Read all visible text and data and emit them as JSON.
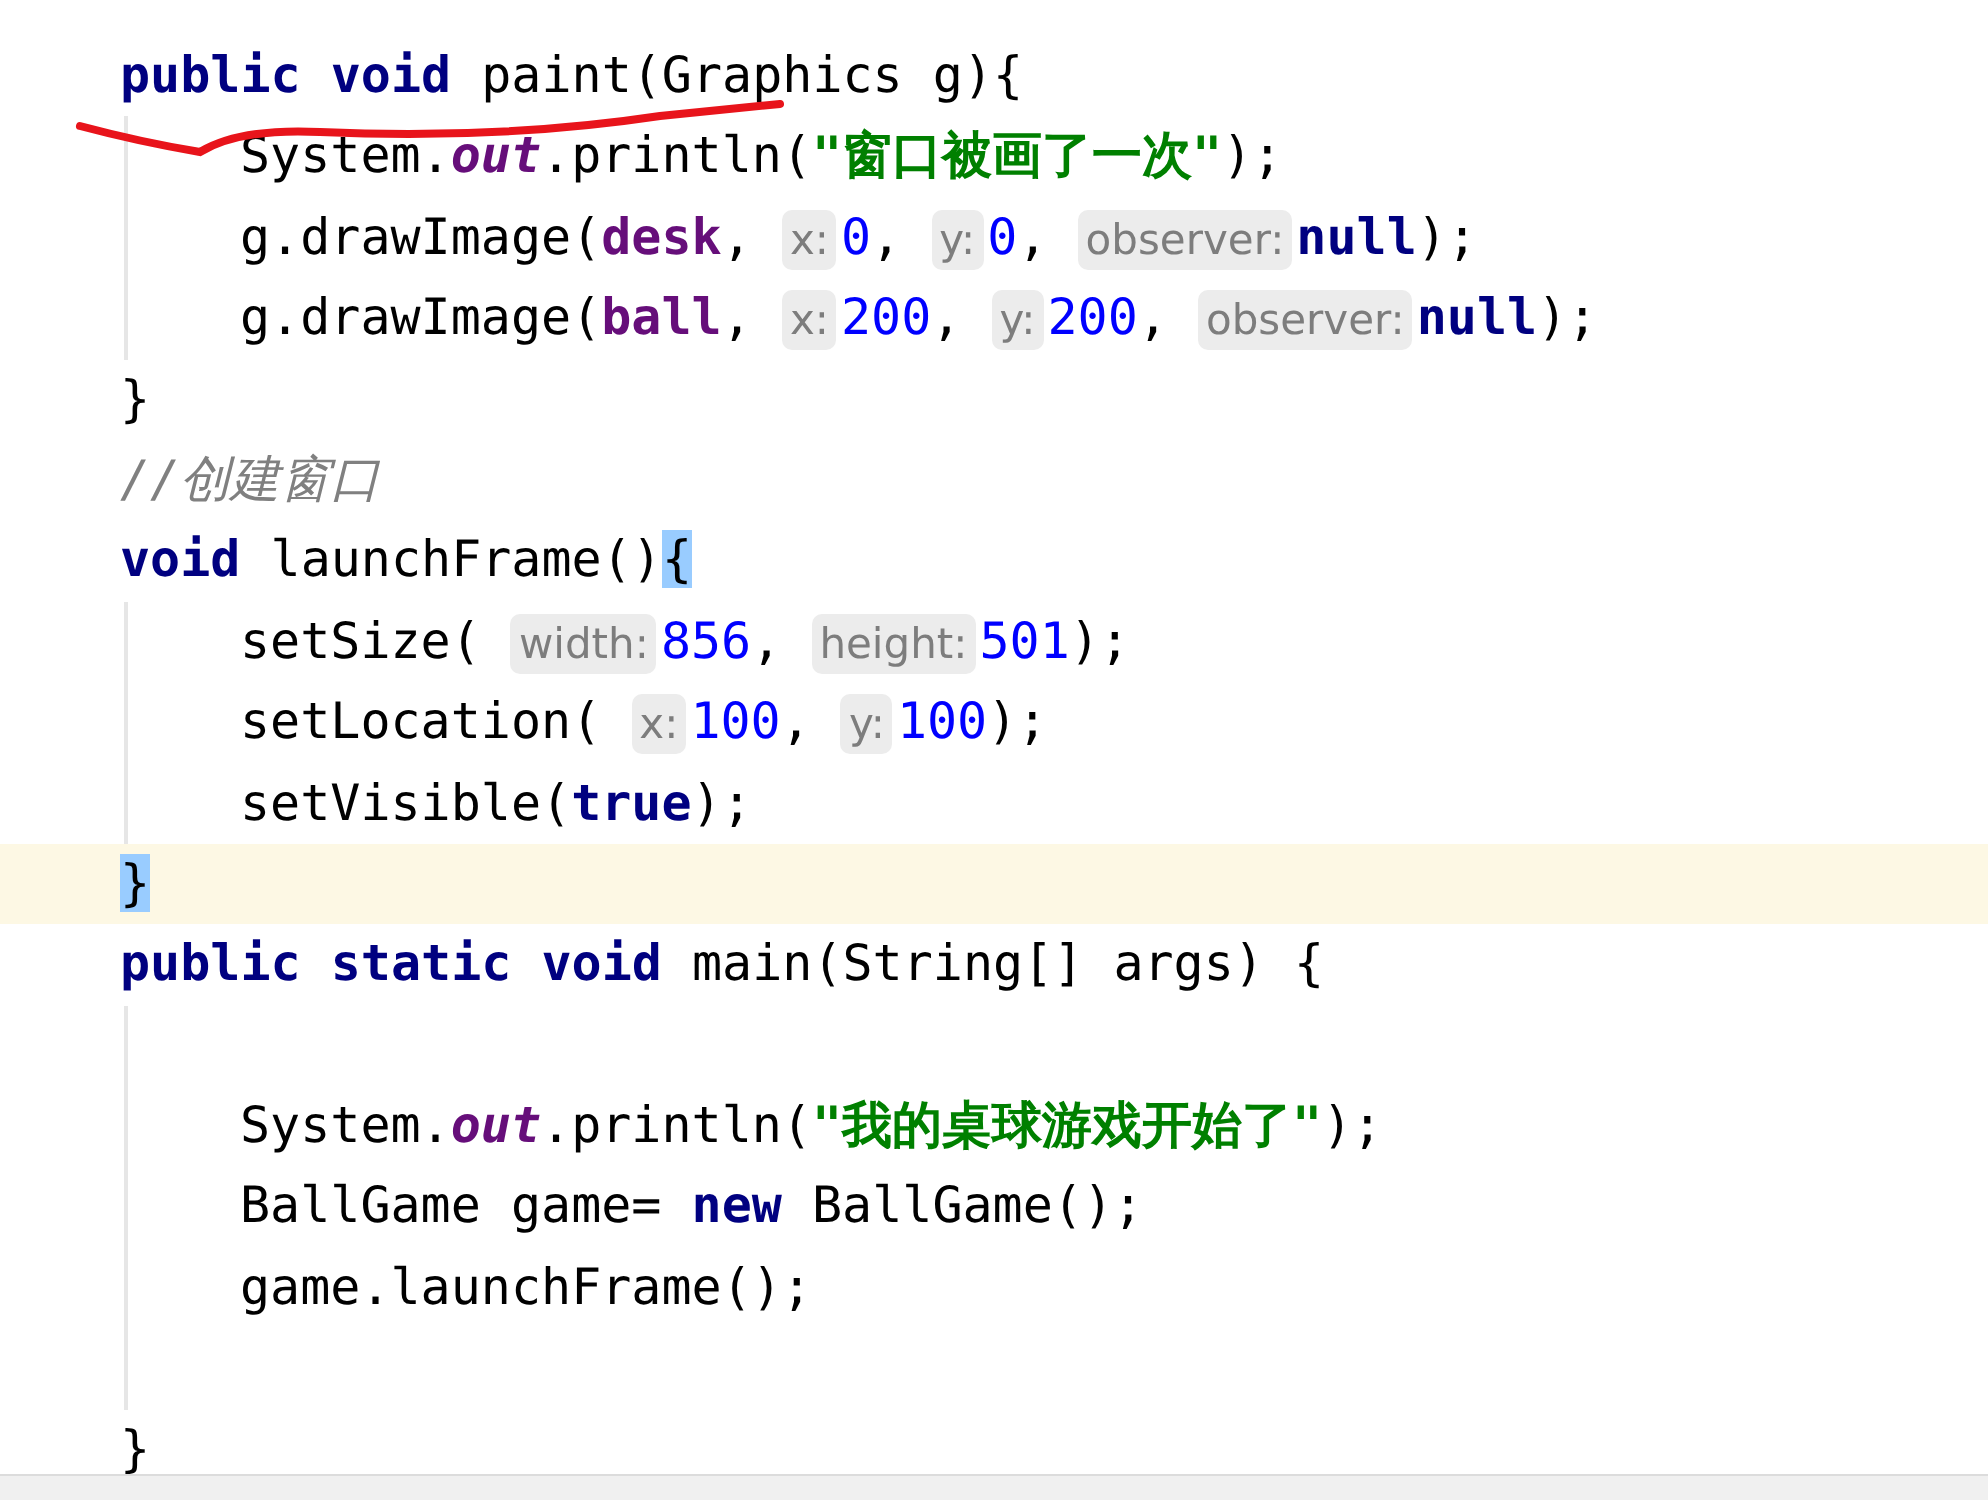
{
  "lines": [
    {
      "current": false,
      "tokens": [
        {
          "kind": "keyword",
          "text": "public void"
        },
        {
          "kind": "plain",
          "text": " paint(Graphics g){"
        }
      ],
      "children": [
        {
          "current": false,
          "tokens": [
            {
              "kind": "plain",
              "text": "System."
            },
            {
              "kind": "static",
              "text": "out"
            },
            {
              "kind": "plain",
              "text": ".println("
            },
            {
              "kind": "string",
              "text": "\"窗口被画了一次\""
            },
            {
              "kind": "plain",
              "text": ");"
            }
          ]
        },
        {
          "current": false,
          "tokens": [
            {
              "kind": "plain",
              "text": "g.drawImage("
            },
            {
              "kind": "field",
              "text": "desk"
            },
            {
              "kind": "plain",
              "text": ", "
            },
            {
              "kind": "hint",
              "text": "x:"
            },
            {
              "kind": "number",
              "text": "0"
            },
            {
              "kind": "plain",
              "text": ", "
            },
            {
              "kind": "hint",
              "text": "y:"
            },
            {
              "kind": "number",
              "text": "0"
            },
            {
              "kind": "plain",
              "text": ", "
            },
            {
              "kind": "hint",
              "text": "observer:"
            },
            {
              "kind": "keyword",
              "text": "null"
            },
            {
              "kind": "plain",
              "text": ");"
            }
          ]
        },
        {
          "current": false,
          "tokens": [
            {
              "kind": "plain",
              "text": "g.drawImage("
            },
            {
              "kind": "field",
              "text": "ball"
            },
            {
              "kind": "plain",
              "text": ", "
            },
            {
              "kind": "hint",
              "text": "x:"
            },
            {
              "kind": "number",
              "text": "200"
            },
            {
              "kind": "plain",
              "text": ", "
            },
            {
              "kind": "hint",
              "text": "y:"
            },
            {
              "kind": "number",
              "text": "200"
            },
            {
              "kind": "plain",
              "text": ", "
            },
            {
              "kind": "hint",
              "text": "observer:"
            },
            {
              "kind": "keyword",
              "text": "null"
            },
            {
              "kind": "plain",
              "text": ");"
            }
          ]
        }
      ]
    },
    {
      "current": false,
      "tokens": [
        {
          "kind": "plain",
          "text": "}"
        }
      ]
    },
    {
      "current": false,
      "tokens": [
        {
          "kind": "comment",
          "text": "//创建窗口"
        }
      ]
    },
    {
      "current": false,
      "tokens": [
        {
          "kind": "keyword",
          "text": "void"
        },
        {
          "kind": "plain",
          "text": " launchFrame()"
        },
        {
          "kind": "brace",
          "text": "{"
        }
      ],
      "children": [
        {
          "current": false,
          "tokens": [
            {
              "kind": "plain",
              "text": "setSize( "
            },
            {
              "kind": "hint",
              "text": "width:"
            },
            {
              "kind": "number",
              "text": "856"
            },
            {
              "kind": "plain",
              "text": ", "
            },
            {
              "kind": "hint",
              "text": "height:"
            },
            {
              "kind": "number",
              "text": "501"
            },
            {
              "kind": "plain",
              "text": ");"
            }
          ]
        },
        {
          "current": false,
          "tokens": [
            {
              "kind": "plain",
              "text": "setLocation( "
            },
            {
              "kind": "hint",
              "text": "x:"
            },
            {
              "kind": "number",
              "text": "100"
            },
            {
              "kind": "plain",
              "text": ", "
            },
            {
              "kind": "hint",
              "text": "y:"
            },
            {
              "kind": "number",
              "text": "100"
            },
            {
              "kind": "plain",
              "text": ");"
            }
          ]
        },
        {
          "current": false,
          "tokens": [
            {
              "kind": "plain",
              "text": "setVisible("
            },
            {
              "kind": "keyword",
              "text": "true"
            },
            {
              "kind": "plain",
              "text": ");"
            }
          ]
        }
      ]
    },
    {
      "current": true,
      "tokens": [
        {
          "kind": "brace",
          "text": "}"
        }
      ]
    },
    {
      "current": false,
      "tokens": [
        {
          "kind": "keyword",
          "text": "public static void"
        },
        {
          "kind": "plain",
          "text": " main(String[] args) {"
        }
      ],
      "children": [
        {
          "current": false
        },
        {
          "current": false,
          "tokens": [
            {
              "kind": "plain",
              "text": "System."
            },
            {
              "kind": "static",
              "text": "out"
            },
            {
              "kind": "plain",
              "text": ".println("
            },
            {
              "kind": "string",
              "text": "\"我的桌球游戏开始了\""
            },
            {
              "kind": "plain",
              "text": ");"
            }
          ]
        },
        {
          "current": false,
          "tokens": [
            {
              "kind": "plain",
              "text": "BallGame game= "
            },
            {
              "kind": "keyword",
              "text": "new"
            },
            {
              "kind": "plain",
              "text": " BallGame();"
            }
          ]
        },
        {
          "current": false,
          "tokens": [
            {
              "kind": "plain",
              "text": "game.launchFrame();"
            }
          ]
        },
        {
          "current": false
        }
      ]
    },
    {
      "current": false,
      "tokens": [
        {
          "kind": "plain",
          "text": "}"
        }
      ]
    }
  ]
}
